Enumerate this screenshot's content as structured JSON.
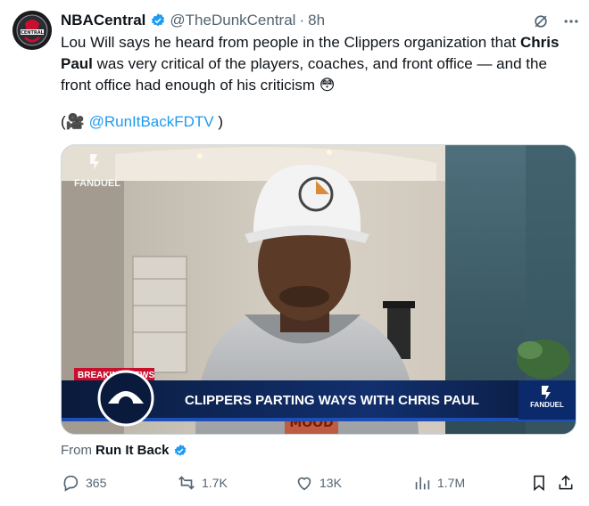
{
  "author": {
    "name": "NBACentral",
    "handle": "@TheDunkCentral",
    "separator": "·",
    "time": "8h",
    "avatar_text": "CENTRAL"
  },
  "tweet": {
    "text_part1": "Lou Will says he heard from people in the Clippers organization that ",
    "text_bold": "Chris Paul",
    "text_part2": " was very critical of the players, coaches, and front office — and the front office had enough of his criticism ",
    "emoji": "😳",
    "credit_open": "(",
    "credit_emoji": "🎥",
    "credit_mention": "@RunItBackFDTV",
    "credit_close": " )"
  },
  "media": {
    "watermark": "FANDUEL",
    "breaking_label": "BREAKING NEWS",
    "headline": "CLIPPERS PARTING WAYS WITH CHRIS PAUL",
    "corner_logo": "FANDUEL",
    "shirt_text": "MOOD"
  },
  "source": {
    "prefix": "From",
    "name": "Run It Back"
  },
  "actions": {
    "replies": "365",
    "reposts": "1.7K",
    "likes": "13K",
    "views": "1.7M"
  },
  "icons": [
    "grok-icon",
    "more-icon",
    "reply-icon",
    "repost-icon",
    "like-icon",
    "views-icon",
    "bookmark-icon",
    "share-icon",
    "verified-badge-icon"
  ],
  "colors": {
    "accent": "#1d9bf0",
    "text": "#0f1419",
    "muted": "#536471",
    "breaking": "#c8102e",
    "banner": "#0a1a3c"
  }
}
